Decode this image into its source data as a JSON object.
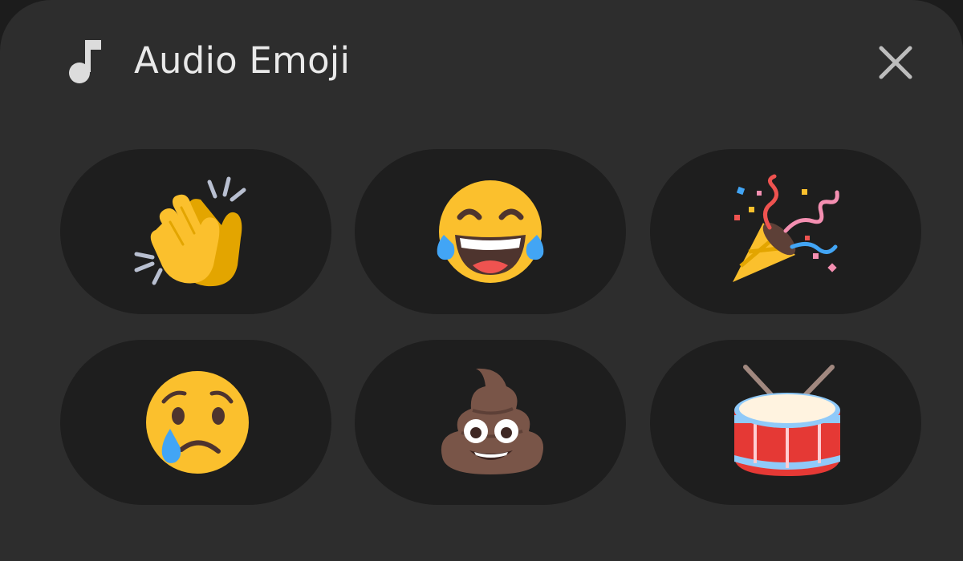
{
  "header": {
    "icon": "music-note-icon",
    "title": "Audio Emoji",
    "close_icon": "close-icon"
  },
  "emojis": [
    {
      "id": "clapping-hands",
      "icon": "clapping-hands-emoji"
    },
    {
      "id": "tears-of-joy",
      "icon": "face-with-tears-of-joy-emoji"
    },
    {
      "id": "party-popper",
      "icon": "party-popper-emoji"
    },
    {
      "id": "crying-face",
      "icon": "crying-face-emoji"
    },
    {
      "id": "pile-of-poo",
      "icon": "pile-of-poo-emoji"
    },
    {
      "id": "drum",
      "icon": "drum-emoji"
    }
  ],
  "colors": {
    "sheet_bg": "#2d2d2d",
    "pill_bg": "#1e1e1e",
    "text": "#e9e9e9",
    "icon": "#dcdcdc"
  }
}
